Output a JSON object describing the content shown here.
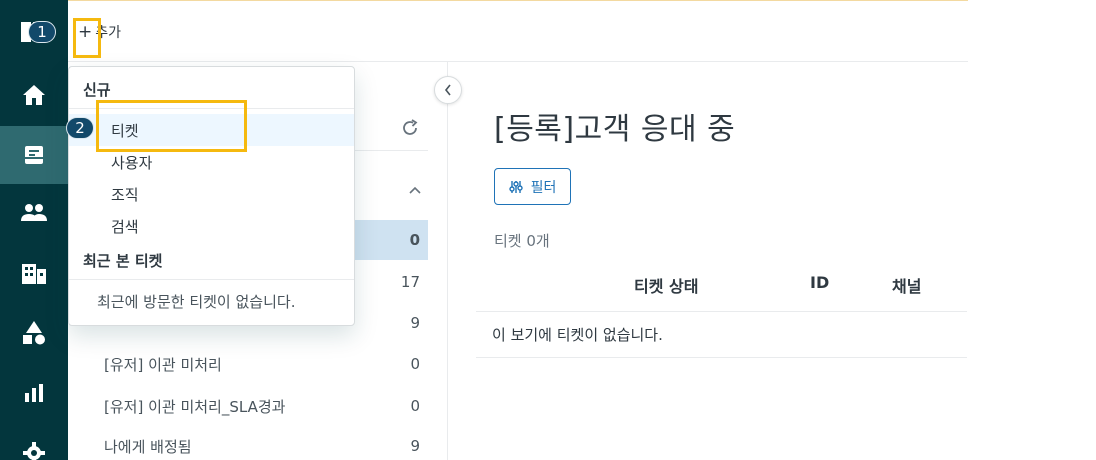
{
  "topbar": {
    "add_label": "추가"
  },
  "markers": {
    "first": "1",
    "second": "2"
  },
  "dropdown": {
    "new_header": "신규",
    "items": [
      "티켓",
      "사용자",
      "조직",
      "검색"
    ],
    "recent_header": "최근 본 티켓",
    "recent_empty": "최근에 방문한 티켓이 없습니다."
  },
  "views": {
    "rows": [
      {
        "label": "",
        "count": "0"
      },
      {
        "label": "",
        "count": "17"
      },
      {
        "label": "",
        "count": "9"
      },
      {
        "label": "[유저] 이관 미처리",
        "count": "0"
      },
      {
        "label": "[유저] 이관 미처리_SLA경과",
        "count": "0"
      },
      {
        "label": "나에게 배정됨",
        "count": "9"
      }
    ]
  },
  "main": {
    "title": "[등록]고객 응대 중",
    "filter_label": "필터",
    "ticket_count": "티켓 0개",
    "columns": [
      "티켓 상태",
      "ID",
      "채널"
    ],
    "empty_message": "이 보기에 티켓이 없습니다."
  },
  "colors": {
    "nav_bg": "#03363d",
    "accent": "#1f73b7",
    "highlight": "#f5b90f",
    "active_row": "#cfe2f1"
  }
}
